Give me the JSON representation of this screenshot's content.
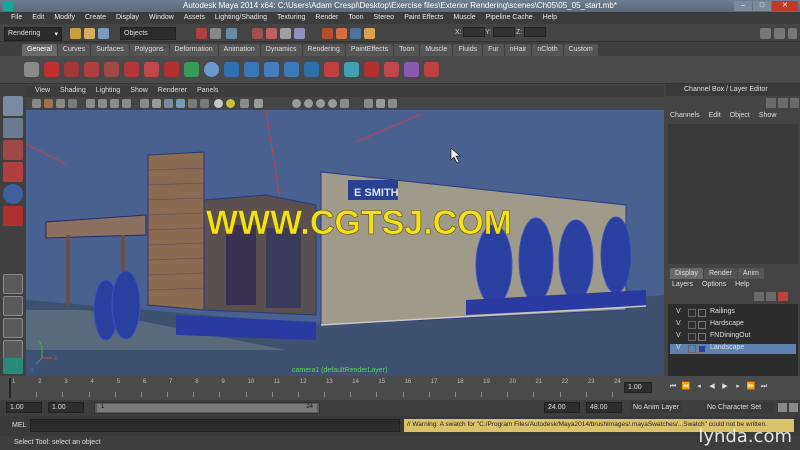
{
  "window": {
    "title": "Autodesk Maya 2014 x64: C:\\Users\\Adam Crespi\\Desktop\\Exercise files\\Exterior Rendering\\scenes\\Ch05\\05_05_start.mb*",
    "btn_min": "–",
    "btn_max": "□",
    "btn_close": "✕"
  },
  "menubar": [
    "File",
    "Edit",
    "Modify",
    "Create",
    "Display",
    "Window",
    "Assets",
    "Lighting/Shading",
    "Texturing",
    "Render",
    "Toon",
    "Stereo",
    "Paint Effects",
    "Muscle",
    "Pipeline Cache",
    "Help"
  ],
  "statusline": {
    "menuset": "Rendering",
    "selmode": "Objects",
    "x": "X:",
    "y": "Y:",
    "z": "Z:"
  },
  "shelf_tabs": [
    "General",
    "Curves",
    "Surfaces",
    "Polygons",
    "Deformation",
    "Animation",
    "Dynamics",
    "Rendering",
    "PaintEffects",
    "Toon",
    "Muscle",
    "Fluids",
    "Fur",
    "nHair",
    "nCloth",
    "Custom"
  ],
  "shelf_active": "General",
  "panel_menu": [
    "View",
    "Shading",
    "Lighting",
    "Show",
    "Renderer",
    "Panels"
  ],
  "viewport": {
    "camera_label": "camera1 (defaultRenderLayer)",
    "sign_text": "E  SMITH",
    "watermark": "WWW.CGTSJ.COM",
    "axis_x": "x",
    "axis_y": "y",
    "axis_z": "z"
  },
  "channelbox": {
    "title": "Channel Box / Layer Editor",
    "menu": [
      "Channels",
      "Edit",
      "Object",
      "Show"
    ],
    "layer_tabs": [
      "Display",
      "Render",
      "Anim"
    ],
    "layer_menu": [
      "Layers",
      "Options",
      "Help"
    ],
    "layers": [
      {
        "v": "V",
        "name": "Railings",
        "selected": false
      },
      {
        "v": "V",
        "name": "Hardscape",
        "selected": false
      },
      {
        "v": "V",
        "name": "FNDiningOut",
        "selected": false
      },
      {
        "v": "V",
        "name": "Landscape",
        "selected": true
      }
    ]
  },
  "timeline": {
    "ticks": [
      "1",
      "2",
      "3",
      "4",
      "5",
      "6",
      "7",
      "8",
      "9",
      "10",
      "11",
      "12",
      "13",
      "14",
      "15",
      "16",
      "17",
      "18",
      "19",
      "20",
      "21",
      "22",
      "23",
      "24"
    ],
    "current": "1.00"
  },
  "range": {
    "start": "1.00",
    "anim_start": "1.00",
    "range_start": "1",
    "range_end": "24",
    "end": "24.00",
    "anim_end": "48.00",
    "anim_layer": "No Anim Layer",
    "character_set": "No Character Set"
  },
  "cmdline": {
    "label": "MEL",
    "warning": "// Warning: A swatch for \"C:/Program Files/Autodesk/Maya2014/brushImages/.mayaSwatches/...Swatch\" could not be written."
  },
  "helpline": {
    "text": "Select Tool: select an object"
  },
  "brand": {
    "watermark": "lynda.com"
  }
}
